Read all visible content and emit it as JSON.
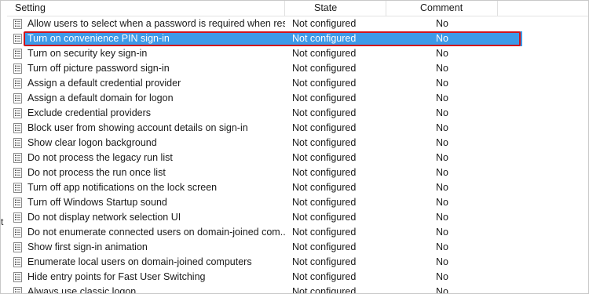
{
  "columns": {
    "setting": "Setting",
    "state": "State",
    "comment": "Comment"
  },
  "stray_char": "t",
  "selected_index": 1,
  "rows": [
    {
      "setting": "Allow users to select when a password is required when resu...",
      "state": "Not configured",
      "comment": "No"
    },
    {
      "setting": "Turn on convenience PIN sign-in",
      "state": "Not configured",
      "comment": "No"
    },
    {
      "setting": "Turn on security key sign-in",
      "state": "Not configured",
      "comment": "No"
    },
    {
      "setting": "Turn off picture password sign-in",
      "state": "Not configured",
      "comment": "No"
    },
    {
      "setting": "Assign a default credential provider",
      "state": "Not configured",
      "comment": "No"
    },
    {
      "setting": "Assign a default domain for logon",
      "state": "Not configured",
      "comment": "No"
    },
    {
      "setting": "Exclude credential providers",
      "state": "Not configured",
      "comment": "No"
    },
    {
      "setting": "Block user from showing account details on sign-in",
      "state": "Not configured",
      "comment": "No"
    },
    {
      "setting": "Show clear logon background",
      "state": "Not configured",
      "comment": "No"
    },
    {
      "setting": "Do not process the legacy run list",
      "state": "Not configured",
      "comment": "No"
    },
    {
      "setting": "Do not process the run once list",
      "state": "Not configured",
      "comment": "No"
    },
    {
      "setting": "Turn off app notifications on the lock screen",
      "state": "Not configured",
      "comment": "No"
    },
    {
      "setting": "Turn off Windows Startup sound",
      "state": "Not configured",
      "comment": "No"
    },
    {
      "setting": "Do not display network selection UI",
      "state": "Not configured",
      "comment": "No"
    },
    {
      "setting": "Do not enumerate connected users on domain-joined com...",
      "state": "Not configured",
      "comment": "No"
    },
    {
      "setting": "Show first sign-in animation",
      "state": "Not configured",
      "comment": "No"
    },
    {
      "setting": "Enumerate local users on domain-joined computers",
      "state": "Not configured",
      "comment": "No"
    },
    {
      "setting": "Hide entry points for Fast User Switching",
      "state": "Not configured",
      "comment": "No"
    },
    {
      "setting": "Always use classic logon",
      "state": "Not configured",
      "comment": "No"
    }
  ],
  "icon": "policy-setting-icon"
}
